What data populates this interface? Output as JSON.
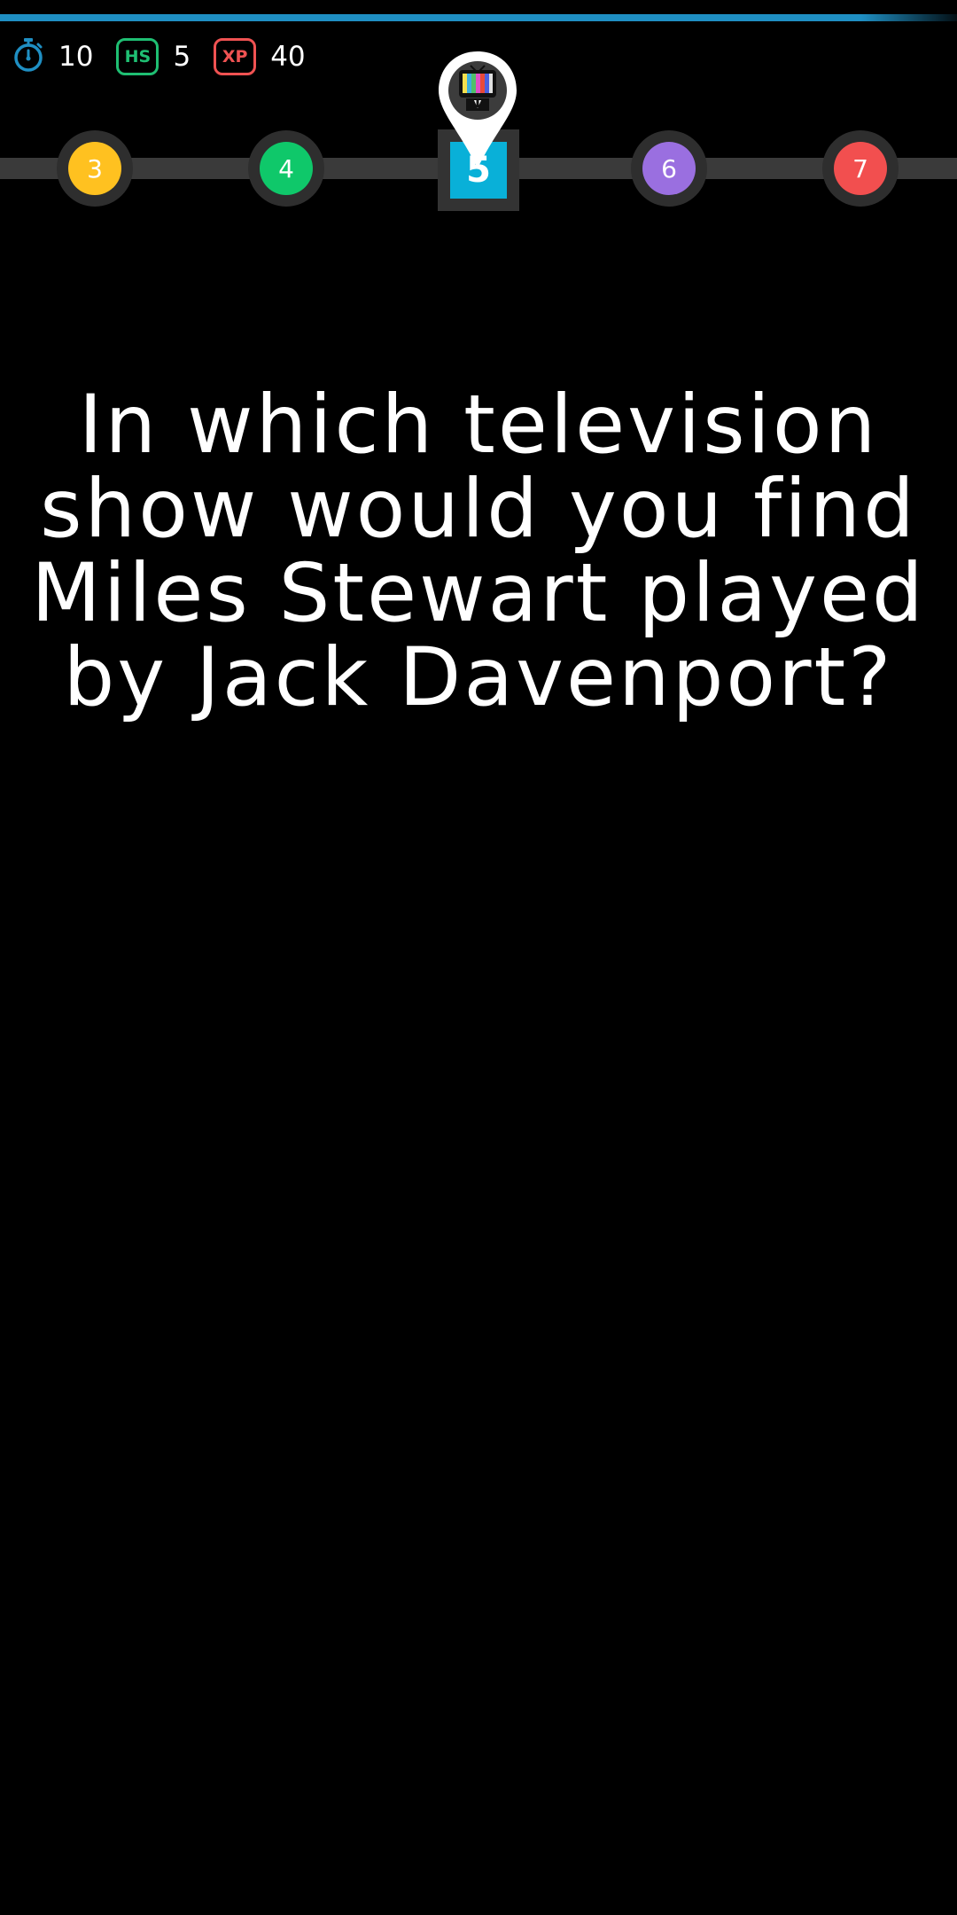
{
  "timer": {
    "remaining_fraction": 0.95,
    "color": "#1f8fc3"
  },
  "stats": {
    "time": {
      "icon": "stopwatch-icon",
      "value": "10"
    },
    "high_score": {
      "badge": "HS",
      "value": "5"
    },
    "xp": {
      "badge": "XP",
      "value": "40"
    }
  },
  "levels": {
    "previous": [
      {
        "number": "3",
        "color": "#ffc120"
      },
      {
        "number": "4",
        "color": "#0fc86a"
      }
    ],
    "current": {
      "number": "5",
      "color": "#09b0d8",
      "category_icon": "television-icon"
    },
    "next": [
      {
        "number": "6",
        "color": "#9a6fe0"
      },
      {
        "number": "7",
        "color": "#f24f4f"
      }
    ]
  },
  "question": {
    "text": "In which television show would you find Miles Stewart played by Jack Davenport?"
  }
}
